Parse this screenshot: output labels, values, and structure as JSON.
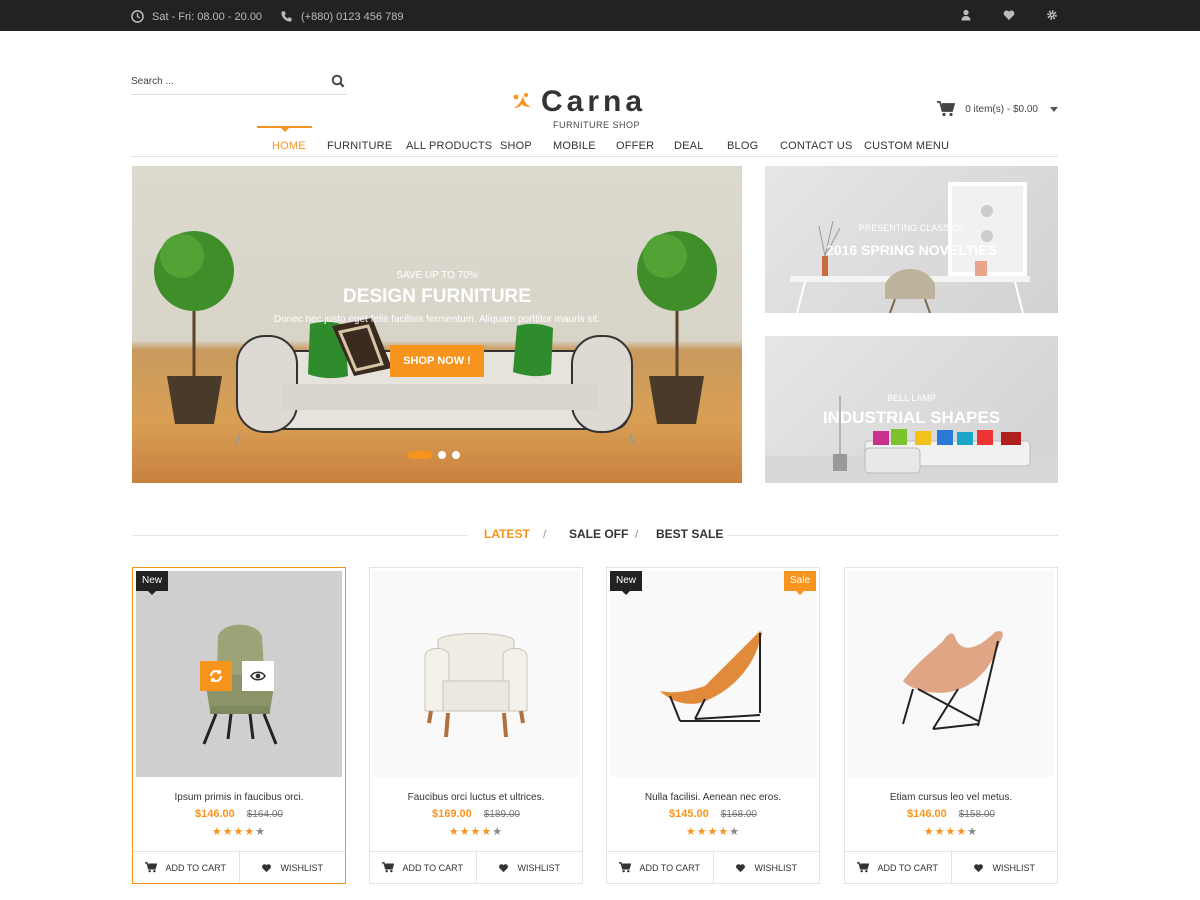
{
  "topbar": {
    "hours": "Sat - Fri: 08.00 - 20.00",
    "phone": "(+880) 0123 456 789"
  },
  "search": {
    "placeholder": "Search ..."
  },
  "logo": {
    "name": "Carna",
    "subtitle": "FURNITURE SHOP"
  },
  "cart": {
    "summary": "0 item(s) - $0.00"
  },
  "nav": {
    "items": [
      "HOME",
      "FURNITURE",
      "ALL PRODUCTS",
      "SHOP",
      "MOBILE",
      "OFFER",
      "DEAL",
      "BLOG",
      "CONTACT US",
      "CUSTOM MENU"
    ]
  },
  "hero": {
    "kicker": "SAVE UP TO 70%",
    "title": "DESIGN FURNITURE",
    "text": "Donec nec justo eget felis facilisis fermentum. Aliquam porttitor mauris sit.",
    "button": "SHOP NOW !"
  },
  "banners": [
    {
      "kicker": "PRESENTING CLASSICS",
      "title": "2016 SPRING NOVELTIES"
    },
    {
      "kicker": "BELL LAMP",
      "title": "INDUSTRIAL SHAPES"
    }
  ],
  "tabs": [
    "LATEST",
    "SALE OFF",
    "BEST SALE"
  ],
  "products": [
    {
      "name": "Ipsum primis in faucibus orci.",
      "price": "$146.00",
      "old": "$164.00",
      "stars": "★★★★",
      "empty": "★",
      "badge_new": "New",
      "badge_sale": ""
    },
    {
      "name": "Faucibus orci luctus et ultrices.",
      "price": "$169.00",
      "old": "$189.00",
      "stars": "★★★★",
      "empty": "★",
      "badge_new": "",
      "badge_sale": ""
    },
    {
      "name": "Nulla facilisi. Aenean nec eros.",
      "price": "$145.00",
      "old": "$168.00",
      "stars": "★★★★",
      "empty": "★",
      "badge_new": "New",
      "badge_sale": "Sale"
    },
    {
      "name": "Etiam cursus leo vel metus.",
      "price": "$146.00",
      "old": "$158.00",
      "stars": "★★★★",
      "empty": "★",
      "badge_new": "",
      "badge_sale": ""
    }
  ],
  "actions": {
    "add_to_cart": "ADD TO CART",
    "wishlist": "WISHLIST"
  },
  "colors": {
    "accent": "#f7941d",
    "topbar": "#222222"
  }
}
